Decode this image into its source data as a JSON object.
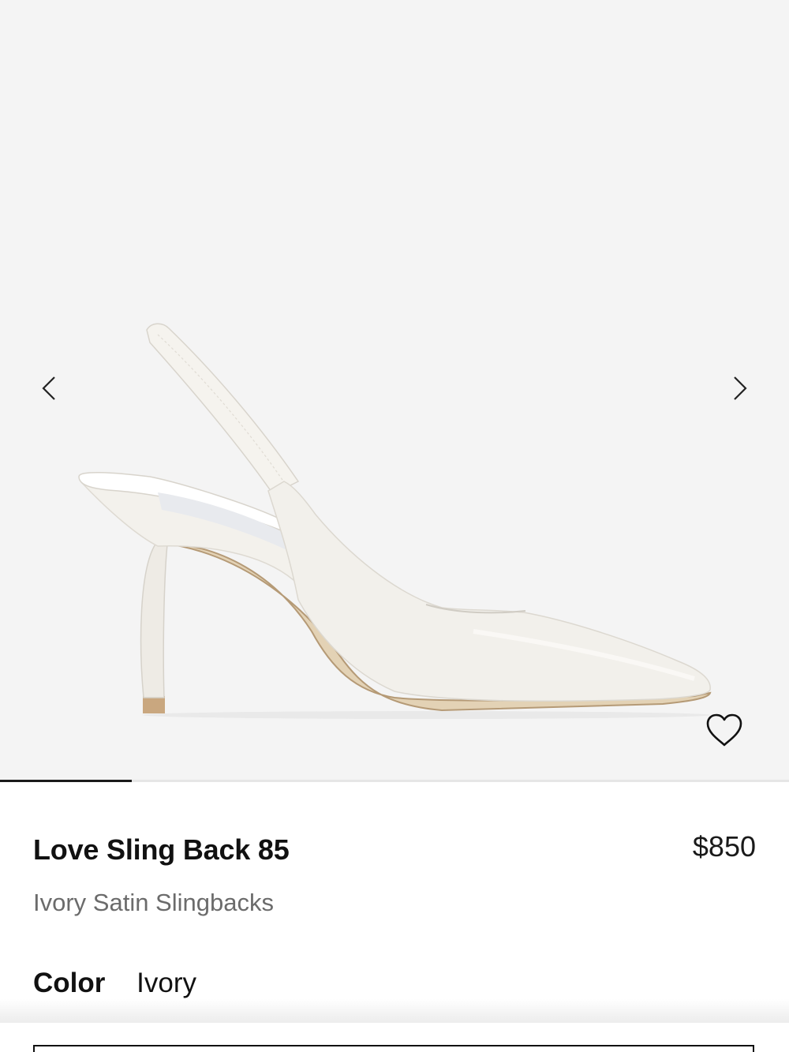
{
  "product": {
    "name": "Love Sling Back 85",
    "subtitle": "Ivory Satin Slingbacks",
    "price": "$850"
  },
  "color": {
    "label": "Color",
    "value": "Ivory"
  },
  "gallery": {
    "image_position": 1,
    "progress_fraction": 0.167,
    "background_color": "#f4f4f4",
    "prev_icon": "chevron-left-icon",
    "next_icon": "chevron-right-icon",
    "wishlist_icon": "heart-icon"
  },
  "colors": {
    "text_primary": "#111111",
    "text_secondary": "#6b6b6b"
  }
}
